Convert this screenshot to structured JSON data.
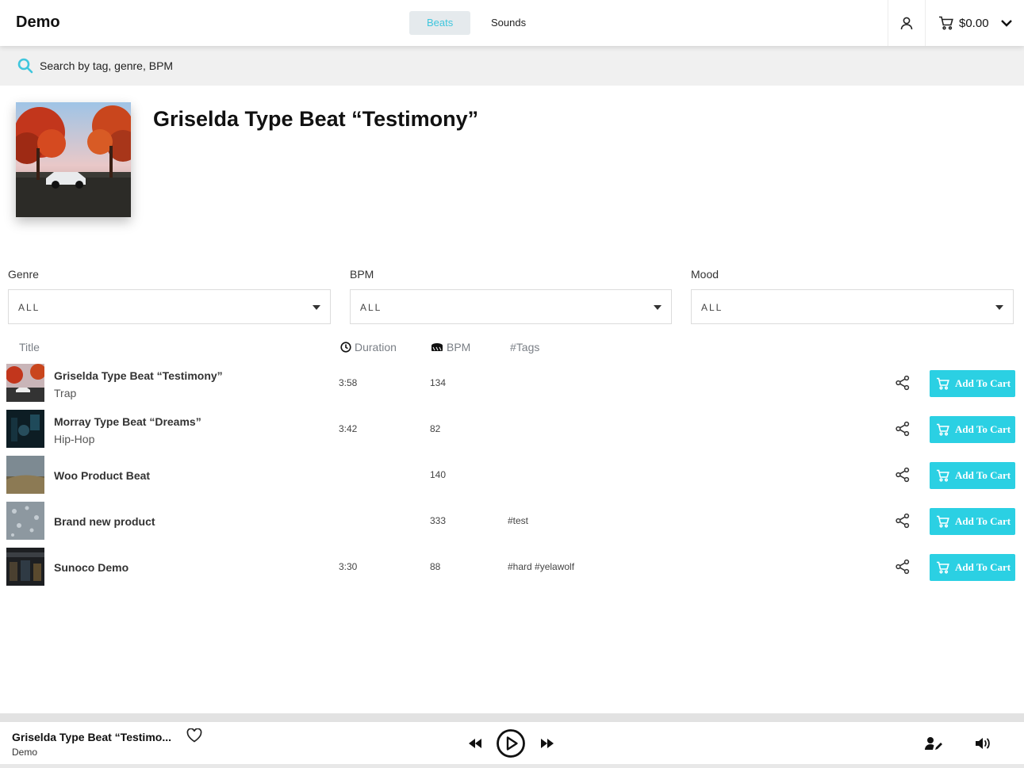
{
  "header": {
    "brand": "Demo",
    "tabs": [
      {
        "label": "Beats",
        "active": true
      },
      {
        "label": "Sounds",
        "active": false
      }
    ],
    "user_icon": "user-icon",
    "cart_icon": "cart-icon",
    "cart_total": "$0.00",
    "dropdown_icon": "chevron-down-icon"
  },
  "search": {
    "placeholder": "Search by tag, genre, BPM",
    "icon": "search-icon"
  },
  "hero": {
    "title": "Griselda Type Beat “Testimony”"
  },
  "filters": [
    {
      "label": "Genre",
      "value": "ALL"
    },
    {
      "label": "BPM",
      "value": "ALL"
    },
    {
      "label": "Mood",
      "value": "ALL"
    }
  ],
  "table": {
    "headers": {
      "title": "Title",
      "duration": "Duration",
      "bpm": "BPM",
      "tags": "#Tags"
    },
    "add_to_cart_label": "Add To Cart",
    "rows": [
      {
        "title": "Griselda Type Beat “Testimony”",
        "genre": "Trap",
        "duration": "3:58",
        "bpm": "134",
        "tags": ""
      },
      {
        "title": "Morray Type Beat “Dreams”",
        "genre": "Hip-Hop",
        "duration": "3:42",
        "bpm": "82",
        "tags": ""
      },
      {
        "title": "Woo Product Beat",
        "genre": "",
        "duration": "",
        "bpm": "140",
        "tags": ""
      },
      {
        "title": "Brand new product",
        "genre": "",
        "duration": "",
        "bpm": "333",
        "tags": "#test"
      },
      {
        "title": "Sunoco Demo",
        "genre": "",
        "duration": "3:30",
        "bpm": "88",
        "tags": "#hard #yelawolf"
      }
    ]
  },
  "player": {
    "title": "Griselda Type Beat “Testimo...",
    "artist": "Demo",
    "icons": [
      "heart-icon",
      "rewind-icon",
      "play-icon",
      "fast-forward-icon",
      "user-edit-icon",
      "volume-icon"
    ]
  },
  "colors": {
    "accent": "#2bd0e3",
    "active_tab_bg": "#e5eaed",
    "search_bg": "#f0f0f0"
  }
}
